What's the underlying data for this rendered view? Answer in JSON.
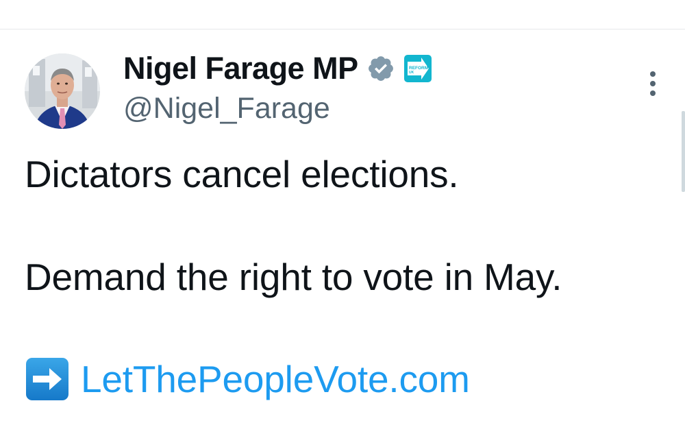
{
  "author": {
    "display_name": "Nigel Farage MP",
    "handle": "@Nigel_Farage",
    "verified_badge": "verified-check-icon",
    "affiliate_badge_text": "REFORM UK",
    "avatar": "profile-photo"
  },
  "tweet": {
    "line_1": "Dictators cancel elections.",
    "line_2": "Demand the right to vote in May.",
    "link_emoji": "right-arrow-emoji",
    "link_text": "LetThePeopleVote.com"
  },
  "colors": {
    "text": "#0f1419",
    "secondary": "#536471",
    "link": "#1d9bf0",
    "verified": "#829aab",
    "reform": "#12b6cf"
  }
}
